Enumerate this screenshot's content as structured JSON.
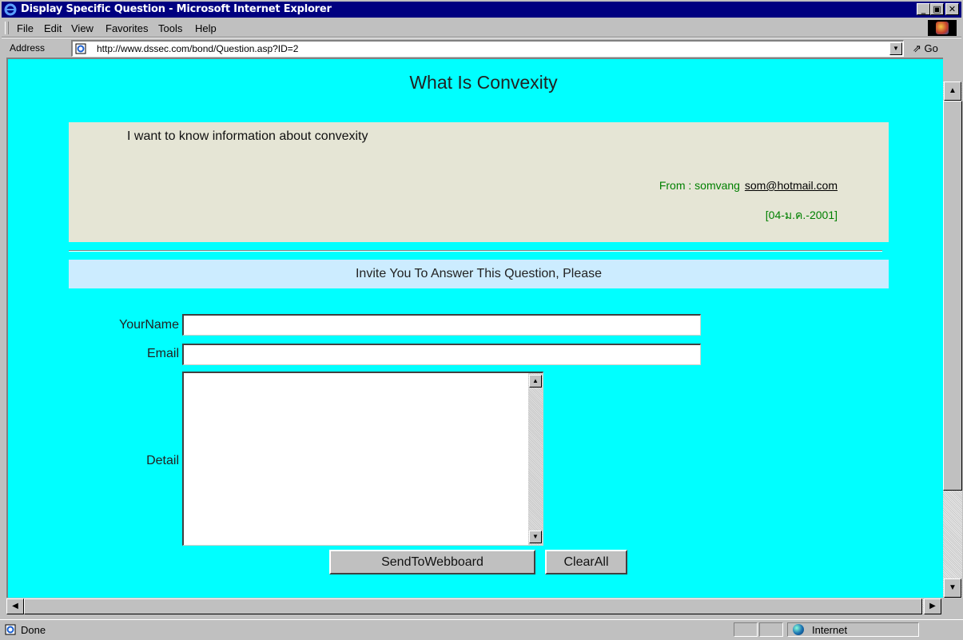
{
  "window": {
    "title": "Display Specific Question - Microsoft Internet Explorer"
  },
  "menu": [
    "File",
    "Edit",
    "View",
    "Favorites",
    "Tools",
    "Help"
  ],
  "address": {
    "label": "Address",
    "url": "http://www.dssec.com/bond/Question.asp?ID=2",
    "go_label": "Go"
  },
  "page": {
    "title": "What Is Convexity",
    "question_text": "I want to know information about convexity",
    "from_prefix": "From : somvang",
    "from_email": "som@hotmail.com",
    "date": "[04-ม.ค.-2001]",
    "invite": "Invite You To Answer This Question, Please",
    "form": {
      "name_label": "YourName",
      "email_label": "Email",
      "detail_label": "Detail",
      "name_value": "",
      "email_value": "",
      "detail_value": "",
      "send_label": "SendToWebboard",
      "clear_label": "ClearAll"
    }
  },
  "status": {
    "text": "Done",
    "zone": "Internet"
  },
  "colors": {
    "titlebar": "#000080",
    "page_bg": "#00ffff",
    "question_bg": "#e5e5d5",
    "invite_bg": "#ccecff",
    "from_text": "#008000"
  }
}
